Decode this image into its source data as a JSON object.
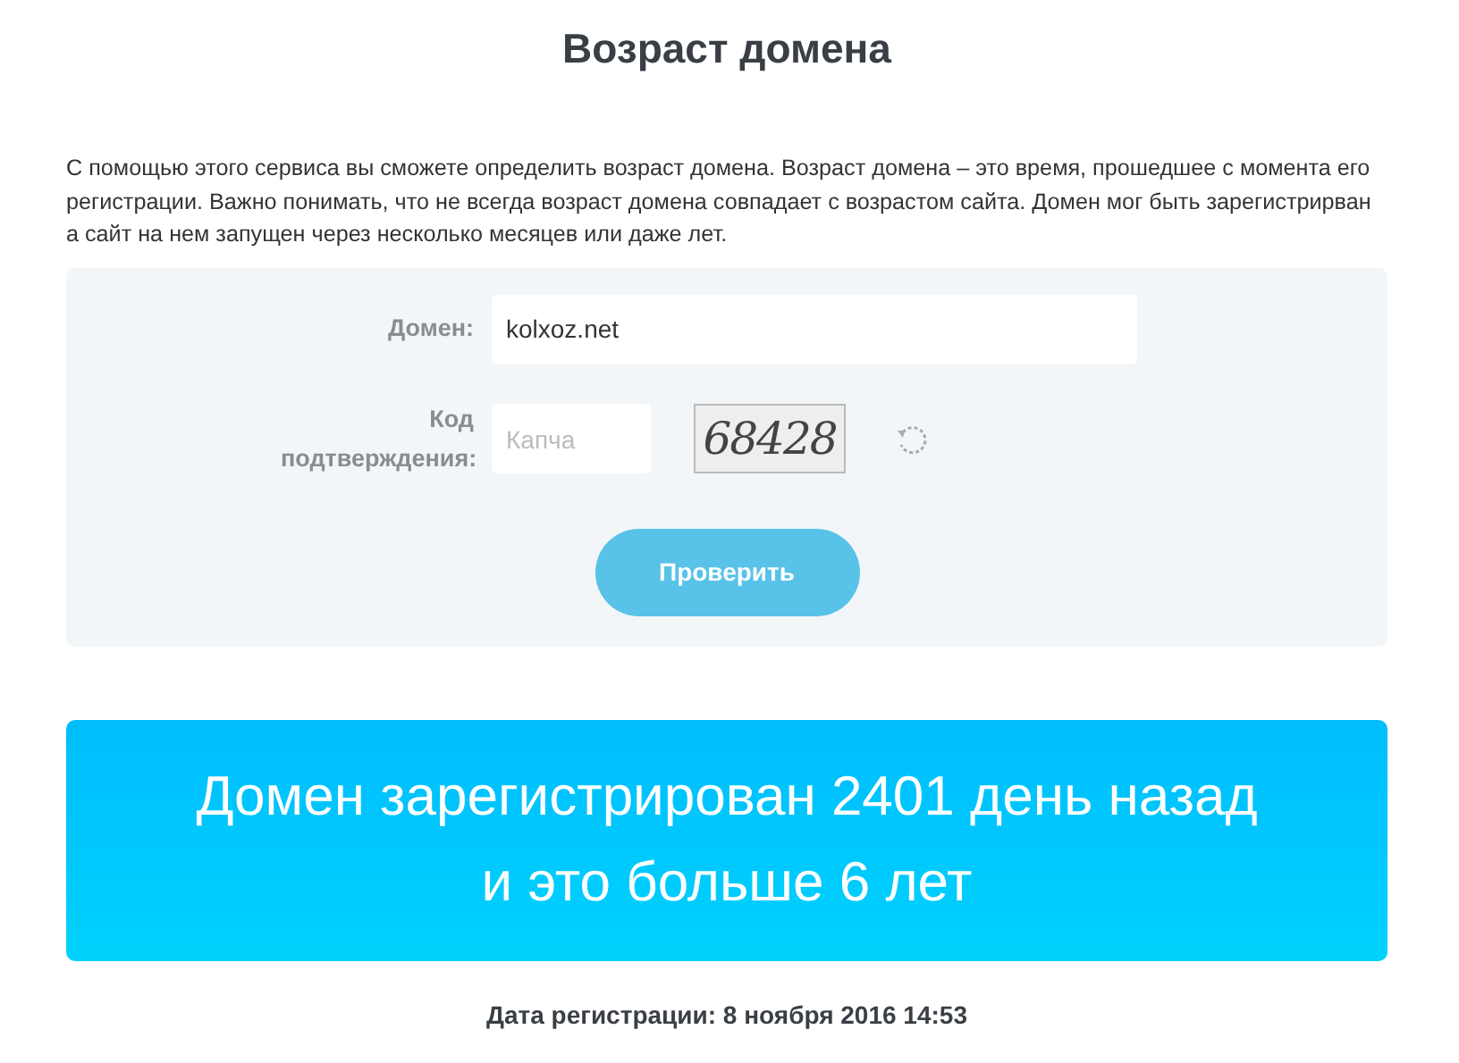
{
  "title": "Возраст домена",
  "description": "С помощью этого сервиса вы сможете определить возраст домена. Возраст домена – это время, прошедшее с момента его регистрации. Важно понимать, что не всегда возраст домена совпадает с возрастом сайта. Домен мог быть зарегистрирван а сайт на нем запущен через несколько месяцев или даже лет.",
  "form": {
    "domain": {
      "label": "Домен:",
      "value": "kolxoz.net"
    },
    "captcha": {
      "label": "Код подтверждения:",
      "placeholder": "Капча",
      "image_text": "68428"
    },
    "submit": "Проверить"
  },
  "result": {
    "lines": [
      "Домен зарегистрирован 2401 день назад",
      "и это больше 6 лет"
    ]
  },
  "registration_date": "Дата регистрации: 8 ноября 2016 14:53"
}
